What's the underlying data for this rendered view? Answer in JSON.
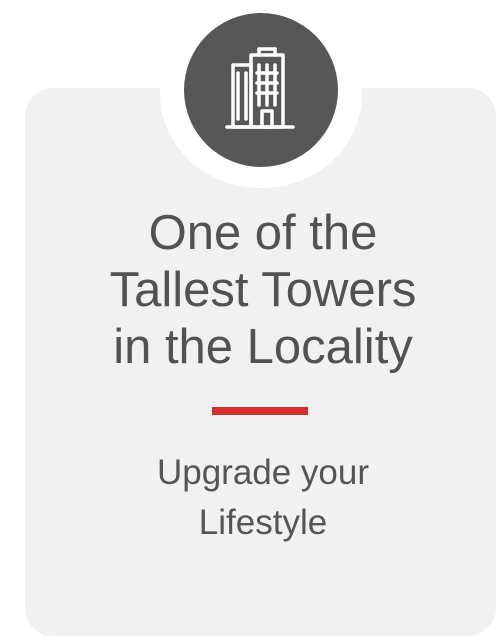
{
  "icon": "building-icon",
  "colors": {
    "card_background": "#f1f1f2",
    "icon_circle": "#575757",
    "title_text": "#525252",
    "accent_bar": "#d32f2f"
  },
  "title": {
    "line1": "One of the",
    "line2": "Tallest Towers",
    "line3": "in the Locality"
  },
  "subtitle": {
    "line1": "Upgrade your",
    "line2": "Lifestyle"
  }
}
